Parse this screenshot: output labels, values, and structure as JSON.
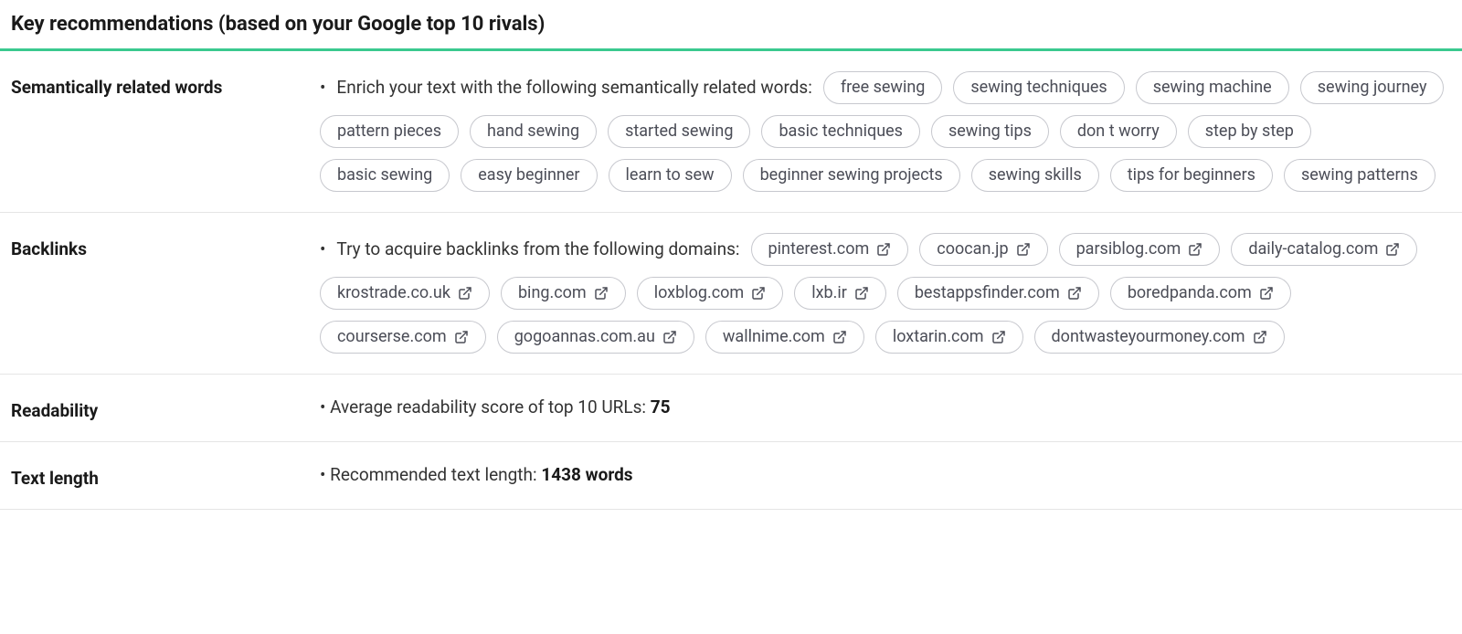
{
  "header": {
    "title": "Key recommendations (based on your Google top 10 rivals)"
  },
  "sections": {
    "semantic": {
      "label": "Semantically related words",
      "lead": "Enrich your text with the following semantically related words:",
      "words": [
        "free sewing",
        "sewing techniques",
        "sewing machine",
        "sewing journey",
        "pattern pieces",
        "hand sewing",
        "started sewing",
        "basic techniques",
        "sewing tips",
        "don t worry",
        "step by step",
        "basic sewing",
        "easy beginner",
        "learn to sew",
        "beginner sewing projects",
        "sewing skills",
        "tips for beginners",
        "sewing patterns"
      ]
    },
    "backlinks": {
      "label": "Backlinks",
      "lead": "Try to acquire backlinks from the following domains:",
      "domains": [
        "pinterest.com",
        "coocan.jp",
        "parsiblog.com",
        "daily-catalog.com",
        "krostrade.co.uk",
        "bing.com",
        "loxblog.com",
        "lxb.ir",
        "bestappsfinder.com",
        "boredpanda.com",
        "courserse.com",
        "gogoannas.com.au",
        "wallnime.com",
        "loxtarin.com",
        "dontwasteyourmoney.com"
      ]
    },
    "readability": {
      "label": "Readability",
      "lead": "Average readability score of top 10 URLs:",
      "value": "75"
    },
    "textlength": {
      "label": "Text length",
      "lead": "Recommended text length:",
      "value": "1438 words"
    }
  }
}
